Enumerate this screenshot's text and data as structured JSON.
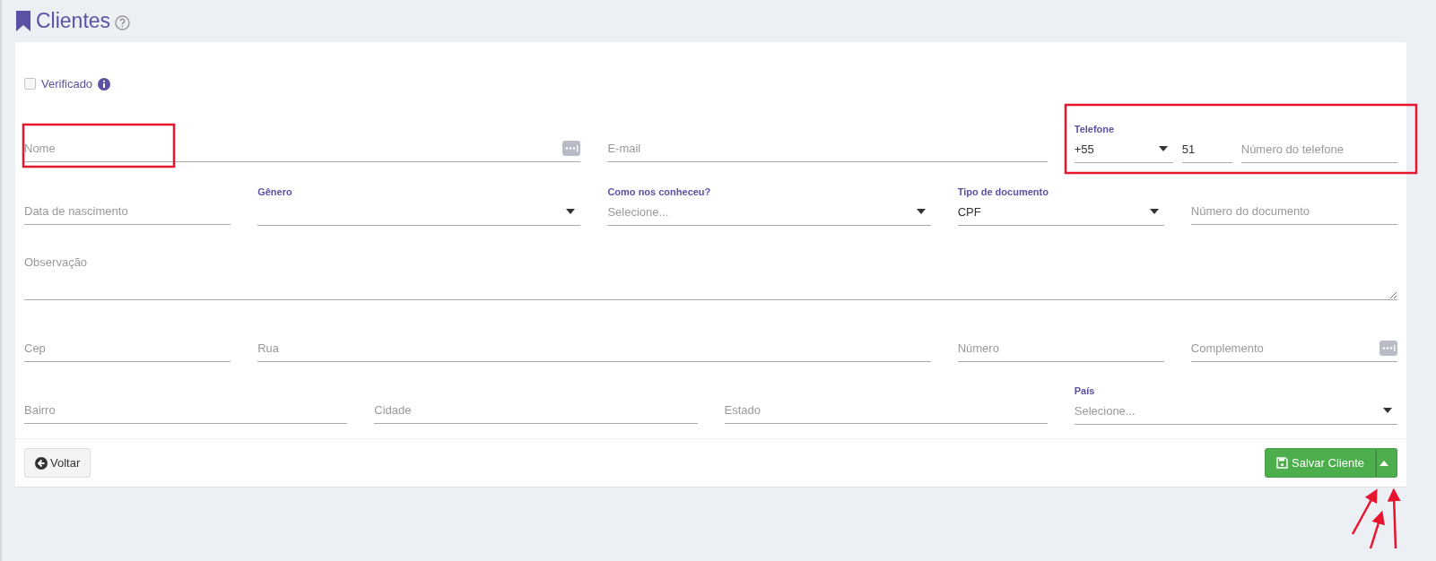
{
  "page": {
    "title": "Clientes"
  },
  "verified": {
    "label": "Verificado",
    "checked": false
  },
  "rows": [
    [
      {
        "kind": "input_addon",
        "placeholder": "Nome"
      },
      {
        "kind": "input",
        "placeholder": "E-mail"
      },
      {
        "kind": "phone",
        "label": "Telefone",
        "code": "+55",
        "area": "51",
        "placeholder": "Número do telefone"
      }
    ],
    [
      {
        "kind": "input",
        "placeholder": "Data de nascimento"
      },
      {
        "kind": "select",
        "label": "Gênero"
      },
      {
        "kind": "select",
        "label": "Como nos conheceu?",
        "placeholder": "Selecione..."
      },
      {
        "kind": "select",
        "label": "Tipo de documento",
        "value": "CPF"
      },
      {
        "kind": "input",
        "placeholder": "Número do documento"
      }
    ],
    [
      {
        "kind": "textarea",
        "placeholder": "Observação"
      }
    ],
    [
      {
        "kind": "input",
        "placeholder": "Cep"
      },
      {
        "kind": "input",
        "placeholder": "Rua"
      },
      {
        "kind": "input",
        "placeholder": "Número"
      },
      {
        "kind": "input_addon",
        "placeholder": "Complemento"
      }
    ],
    [
      {
        "kind": "input",
        "placeholder": "Bairro"
      },
      {
        "kind": "input",
        "placeholder": "Cidade"
      },
      {
        "kind": "input",
        "placeholder": "Estado"
      },
      {
        "kind": "select",
        "label": "País",
        "placeholder": "Selecione..."
      }
    ]
  ],
  "footer": {
    "back": "Voltar",
    "save": "Salvar Cliente"
  }
}
